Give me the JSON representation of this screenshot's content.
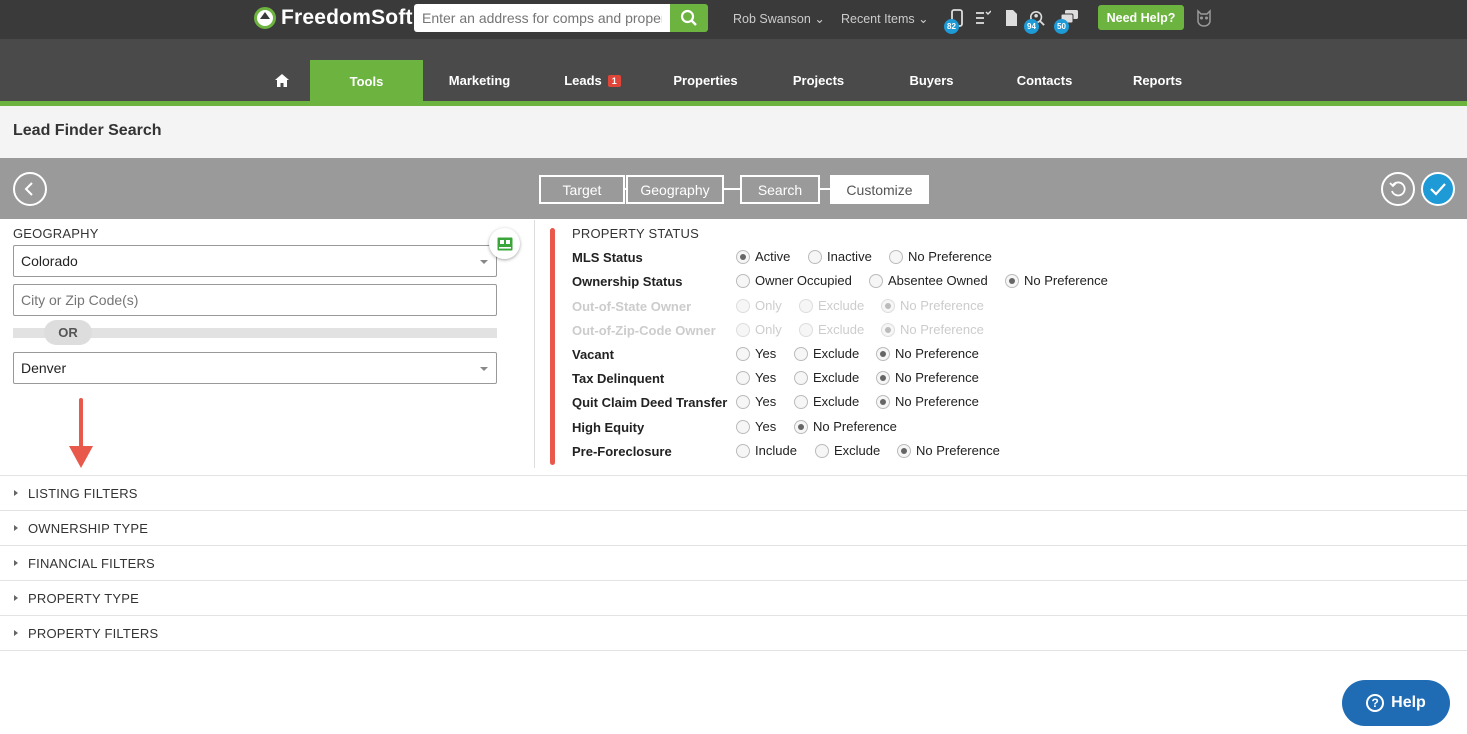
{
  "app": {
    "brand": "FreedomSoft",
    "search_placeholder": "Enter an address for comps and property",
    "user": "Rob Swanson",
    "recent_items": "Recent Items",
    "need_help": "Need Help?",
    "badges": {
      "phone": "82",
      "search": "94",
      "chat": "50"
    }
  },
  "nav": {
    "items": [
      {
        "label": "Tools"
      },
      {
        "label": "Marketing"
      },
      {
        "label": "Leads",
        "badge": "1"
      },
      {
        "label": "Properties"
      },
      {
        "label": "Projects"
      },
      {
        "label": "Buyers"
      },
      {
        "label": "Contacts"
      },
      {
        "label": "Reports"
      }
    ]
  },
  "page": {
    "title": "Lead Finder Search"
  },
  "steps": [
    "Target",
    "Geography",
    "Search",
    "Customize"
  ],
  "geography": {
    "heading": "GEOGRAPHY",
    "state": "Colorado",
    "city_placeholder": "City or Zip Code(s)",
    "or_label": "OR",
    "county": "Denver"
  },
  "property_status": {
    "heading": "PROPERTY STATUS",
    "rows": [
      {
        "label": "MLS Status",
        "options": [
          "Active",
          "Inactive",
          "No Preference"
        ],
        "selected": 0
      },
      {
        "label": "Ownership Status",
        "options": [
          "Owner Occupied",
          "Absentee Owned",
          "No Preference"
        ],
        "selected": 2
      },
      {
        "label": "Out-of-State Owner",
        "options": [
          "Only",
          "Exclude",
          "No Preference"
        ],
        "selected": 2,
        "disabled": true
      },
      {
        "label": "Out-of-Zip-Code Owner",
        "options": [
          "Only",
          "Exclude",
          "No Preference"
        ],
        "selected": 2,
        "disabled": true
      },
      {
        "label": "Vacant",
        "options": [
          "Yes",
          "Exclude",
          "No Preference"
        ],
        "selected": 2
      },
      {
        "label": "Tax Delinquent",
        "options": [
          "Yes",
          "Exclude",
          "No Preference"
        ],
        "selected": 2
      },
      {
        "label": "Quit Claim Deed Transfer",
        "options": [
          "Yes",
          "Exclude",
          "No Preference"
        ],
        "selected": 2
      },
      {
        "label": "High Equity",
        "options": [
          "Yes",
          "No Preference"
        ],
        "selected": 1
      },
      {
        "label": "Pre-Foreclosure",
        "options": [
          "Include",
          "Exclude",
          "No Preference"
        ],
        "selected": 2
      }
    ]
  },
  "accordions": [
    "LISTING FILTERS",
    "OWNERSHIP TYPE",
    "FINANCIAL FILTERS",
    "PROPERTY TYPE",
    "PROPERTY FILTERS"
  ],
  "help_widget": {
    "label": "Help"
  },
  "colors": {
    "brand_green": "#6cb33f",
    "accent_red": "#e8584b",
    "help_blue": "#1f6cb5"
  }
}
